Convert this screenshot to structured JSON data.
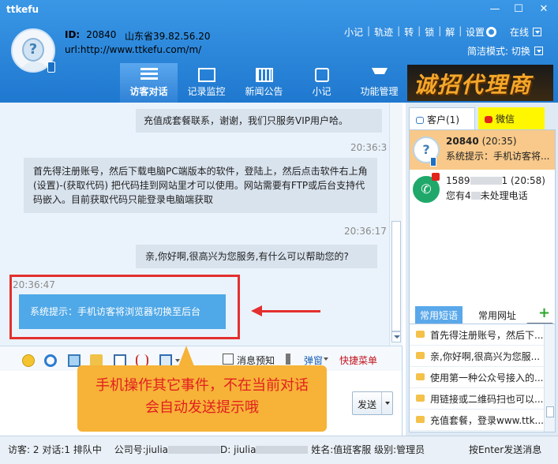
{
  "app_title": "ttkefu",
  "window": {
    "min": "—",
    "max": "☐",
    "close": "✕"
  },
  "user": {
    "id_label": "ID:",
    "id_value": "20840",
    "location": "山东省39.82.56.20",
    "url": "url:http://www.ttkefu.com/m/"
  },
  "toplinks": [
    "小记",
    "轨迹",
    "转",
    "锁",
    "解"
  ],
  "settings_label": "设置",
  "online_label": "在线",
  "mode_label": "简洁模式: 切换",
  "nav_tabs": [
    {
      "label": "访客对话",
      "icon": "list-icon"
    },
    {
      "label": "记录监控",
      "icon": "mail-icon"
    },
    {
      "label": "新闻公告",
      "icon": "film-icon"
    },
    {
      "label": "小记",
      "icon": "note-icon"
    },
    {
      "label": "功能管理",
      "icon": "function-icon"
    }
  ],
  "banner_text": "诚招代理商",
  "messages": {
    "m1": "充值成套餐联系，谢谢，我们只服务VIP用户哈。",
    "t1": "20:36:3",
    "m2": "首先得注册账号，然后下载电脑PC端版本的软件，登陆上，然后点击软件右上角(设置)-(获取代码) 把代码挂到网站里才可以使用。网站需要有FTP或后台支持代码嵌入。目前获取代码只能登录电脑端获取",
    "t2": "20:36:17",
    "m3": "亲,你好啊,很高兴为您服务,有什么可以帮助您的?",
    "t3": "20:36:47",
    "m4": "系统提示：手机访客将浏览器切换至后台"
  },
  "toolbar": {
    "msg_preview": "消息预知",
    "popup": "弹窗",
    "quick_menu": "快捷菜单"
  },
  "send_label": "发送",
  "callout": {
    "line1": "手机操作其它事件，不在当前对话",
    "line2": "会自动发送提示哦"
  },
  "right_tabs": {
    "customer": "客户(1)",
    "wechat": "微信"
  },
  "contacts": [
    {
      "title": "20840",
      "time": "(20:35)",
      "preview": "系统提示：手机访客将..."
    },
    {
      "title_prefix": "1589",
      "title_suffix": "1 (20:58)",
      "preview_prefix": "您有4",
      "preview_suffix": "未处理电话"
    }
  ],
  "top_label": "top",
  "shortcut_tabs": {
    "common_text": "常用短语",
    "common_url": "常用网址"
  },
  "phrases": [
    "首先得注册账号，然后下...",
    "亲,你好啊,很高兴为您服...",
    "使用第一种公众号接入的...",
    "用链接或二维码扫也可以...",
    "充值套餐，登录www.ttk..."
  ],
  "status": {
    "visitors": "访客: 2",
    "dialogs": "对话:1",
    "queue": "排队中",
    "company_label": "公司号:jiulia",
    "id_label": "D: jiulia",
    "name": "姓名:值班客服",
    "level": "级别:管理员",
    "hint": "按Enter发送消息"
  }
}
